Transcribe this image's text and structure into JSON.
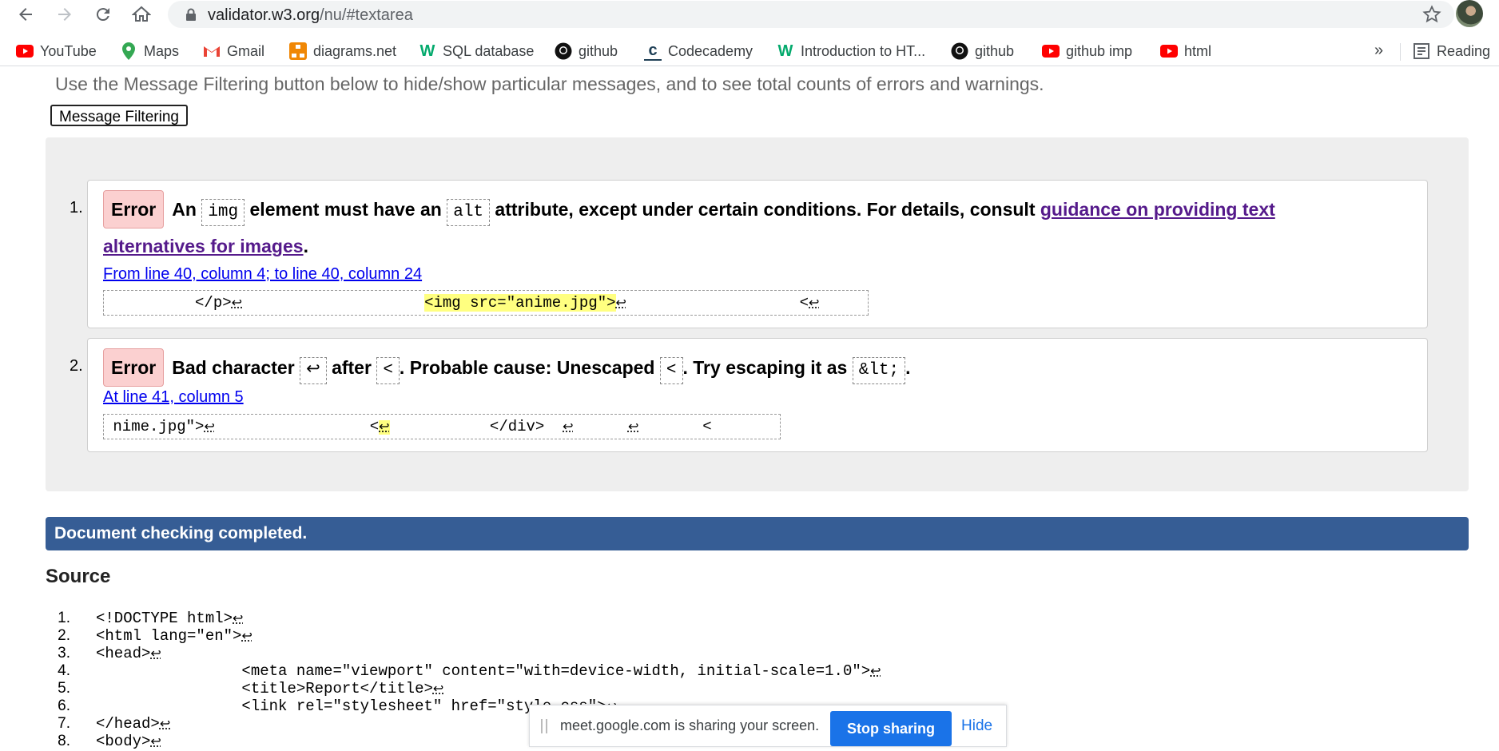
{
  "browser": {
    "url_domain": "validator.w3.org",
    "url_path": "/nu/#textarea",
    "bookmarks": [
      {
        "label": "YouTube",
        "icon": "youtube-icon",
        "color": "#ff0000"
      },
      {
        "label": "Maps",
        "icon": "maps-pin-icon",
        "color": "#34a853"
      },
      {
        "label": "Gmail",
        "icon": "gmail-icon",
        "color": "#ea4335"
      },
      {
        "label": "diagrams.net",
        "icon": "diagrams-icon",
        "color": "#f08705"
      },
      {
        "label": "SQL database",
        "icon": "w3schools-icon",
        "color": "#04aa6d"
      },
      {
        "label": "github",
        "icon": "github-icon",
        "color": "#000000"
      },
      {
        "label": "Codecademy",
        "icon": "codecademy-icon",
        "color": "#1f4056"
      },
      {
        "label": "Introduction to HT...",
        "icon": "w3schools-icon",
        "color": "#04aa6d"
      },
      {
        "label": "github",
        "icon": "github-icon",
        "color": "#000000"
      },
      {
        "label": "github imp",
        "icon": "youtube-icon",
        "color": "#ff0000"
      },
      {
        "label": "html",
        "icon": "youtube-icon",
        "color": "#ff0000"
      }
    ],
    "more_bookmarks": "»",
    "reading_list": "Reading"
  },
  "page": {
    "filter_hint": "Use the Message Filtering button below to hide/show particular messages, and to see total counts of errors and warnings.",
    "filter_button": "Message Filtering",
    "messages": [
      {
        "number": "1.",
        "type": "Error",
        "t1": "An",
        "c1": "img",
        "t2": "element must have an",
        "c2": "alt",
        "t3": "attribute, except under certain conditions. For details, consult",
        "link": "guidance on providing text alternatives for images",
        "t4": ".",
        "location": "From line 40, column 4; to line 40, column 24",
        "extract_before": "          </p>",
        "extract_hl": "<img src=\"anime.jpg\">",
        "extract_after": "<"
      },
      {
        "number": "2.",
        "type": "Error",
        "t1": "Bad character",
        "c1": "↩",
        "t2": "after",
        "c2": "<",
        "t3": ". Probable cause: Unescaped",
        "c3": "<",
        "t4": ". Try escaping it as",
        "c4": "&lt;",
        "t5": ".",
        "location": "At line 41, column 5",
        "extract_before": "nime.jpg\">",
        "extract_lt": "<",
        "extract_after": "</div>"
      }
    ],
    "return_symbol": "↩",
    "done_text": "Document checking completed.",
    "source_heading": "Source",
    "source_lines": [
      {
        "n": "1.",
        "code": "<!DOCTYPE html>"
      },
      {
        "n": "2.",
        "code": "<html lang=\"en\">"
      },
      {
        "n": "3.",
        "code": "<head>"
      },
      {
        "n": "4.",
        "code": "                <meta name=\"viewport\" content=\"with=device-width, initial-scale=1.0\">"
      },
      {
        "n": "5.",
        "code": "                <title>Report</title>"
      },
      {
        "n": "6.",
        "code": "                <link rel=\"stylesheet\" href=\"style.css\">"
      },
      {
        "n": "7.",
        "code": "</head>"
      },
      {
        "n": "8.",
        "code": "<body>"
      }
    ]
  },
  "share_bar": {
    "text": "meet.google.com is sharing your screen.",
    "stop": "Stop sharing",
    "hide": "Hide"
  }
}
